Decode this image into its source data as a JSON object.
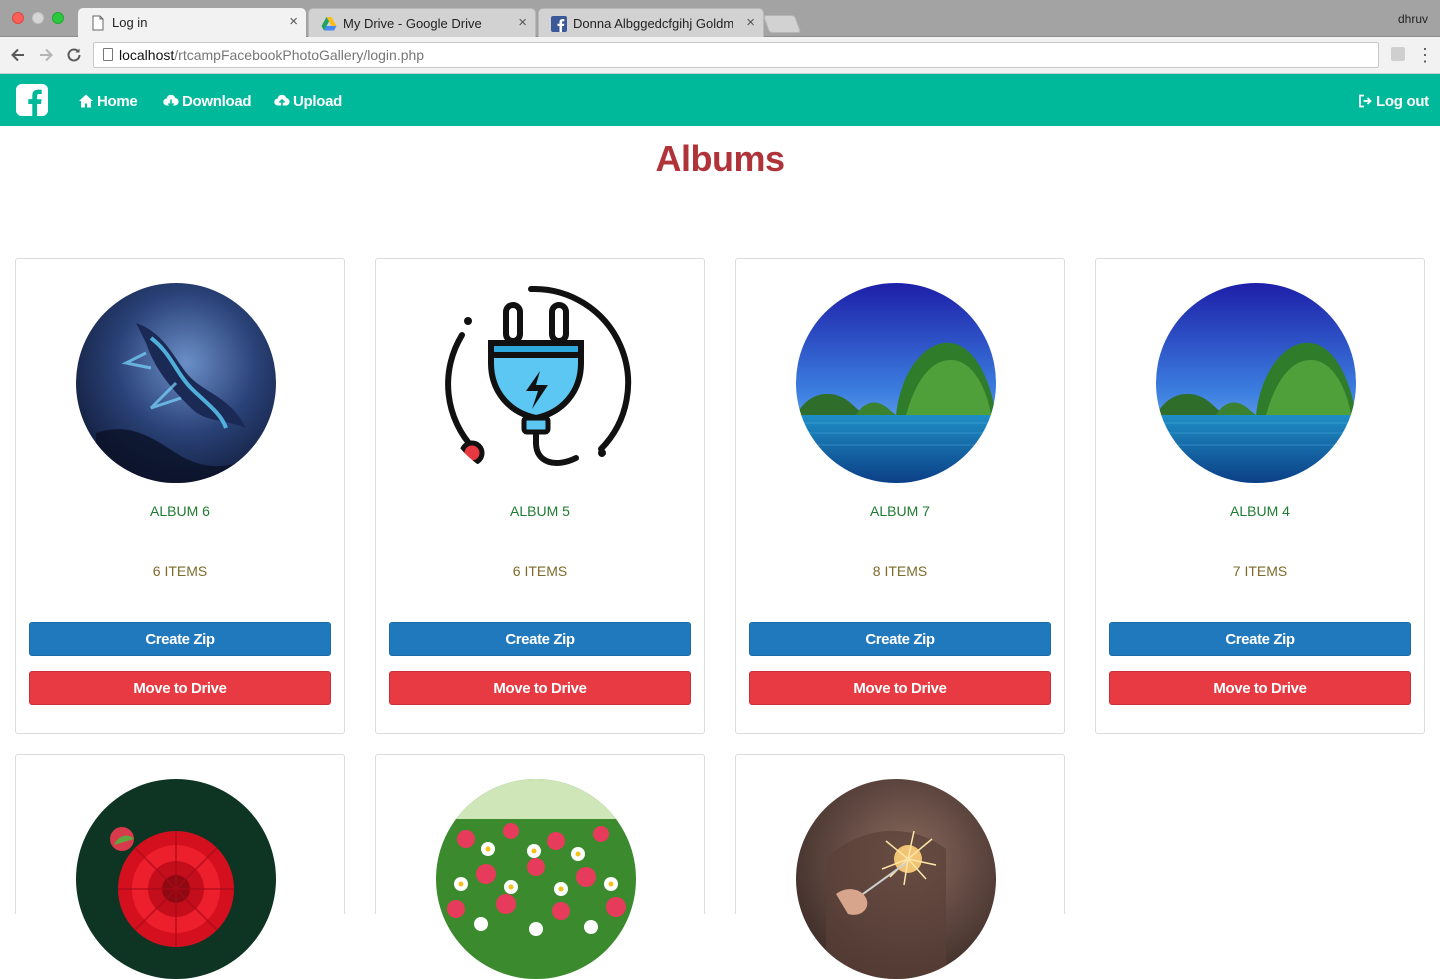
{
  "browser": {
    "tabs": [
      {
        "title": "Log in",
        "close": "×",
        "active": true
      },
      {
        "title": "My Drive - Google Drive",
        "close": "×",
        "active": false
      },
      {
        "title": "Donna Albggedcfgihj Goldman",
        "close": "×",
        "active": false
      }
    ],
    "profile": "dhruv",
    "url_host": "localhost",
    "url_path": "/rtcampFacebookPhotoGallery/login.php",
    "menu": "⋮"
  },
  "navbar": {
    "home": "Home",
    "download": "Download",
    "upload": "Upload",
    "logout": "Log out",
    "color": "#00b89a"
  },
  "page": {
    "title": "Albums",
    "title_color": "#b0333a"
  },
  "albums": [
    {
      "name": "ALBUM 6",
      "count": "6 ITEMS",
      "zip_label": "Create Zip",
      "drive_label": "Move to Drive",
      "thumb": "dragon"
    },
    {
      "name": "ALBUM 5",
      "count": "6 ITEMS",
      "zip_label": "Create Zip",
      "drive_label": "Move to Drive",
      "thumb": "plug-icon"
    },
    {
      "name": "ALBUM 7",
      "count": "8 ITEMS",
      "zip_label": "Create Zip",
      "drive_label": "Move to Drive",
      "thumb": "island"
    },
    {
      "name": "ALBUM 4",
      "count": "7 ITEMS",
      "zip_label": "Create Zip",
      "drive_label": "Move to Drive",
      "thumb": "island"
    },
    {
      "thumb": "red-flower"
    },
    {
      "thumb": "flower-field"
    },
    {
      "thumb": "sparkler"
    }
  ],
  "colors": {
    "zip_button": "#2078bd",
    "drive_button": "#e83a43",
    "album_name": "#1e7d32",
    "album_count": "#7d6a2c"
  }
}
